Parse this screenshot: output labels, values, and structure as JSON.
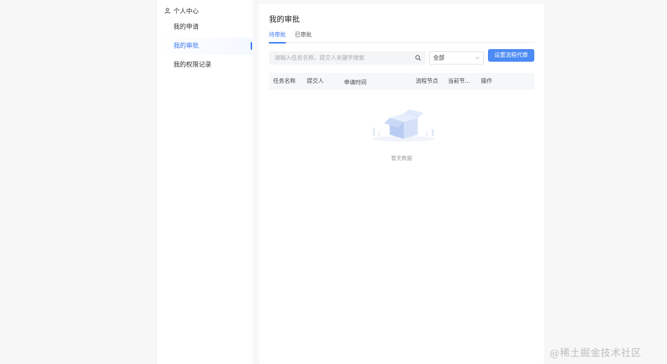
{
  "sidebar": {
    "header": {
      "icon": "person-icon",
      "label": "个人中心"
    },
    "items": [
      {
        "label": "我的申请",
        "active": false
      },
      {
        "label": "我的审批",
        "active": true
      },
      {
        "label": "我的权限记录",
        "active": false
      }
    ]
  },
  "main": {
    "title": "我的审批",
    "tabs": [
      {
        "label": "待审批",
        "active": true
      },
      {
        "label": "已审批",
        "active": false
      }
    ],
    "search": {
      "placeholder": "请输入任务名称、提交人关键字搜索",
      "value": "",
      "icon": "search-icon"
    },
    "filter": {
      "selected": "全部",
      "icon": "chevron-down-icon"
    },
    "action_button": {
      "label": "设置流程代审"
    },
    "table": {
      "columns": [
        "任务名称",
        "提交人",
        "申请时间",
        "流程节点",
        "当前节...",
        "操作"
      ],
      "rows": []
    },
    "empty": {
      "text": "暂无数据",
      "icon": "empty-box-icon"
    }
  },
  "watermark": "@稀土掘金技术社区",
  "colors": {
    "accent": "#3a7af2",
    "button": "#4c8bf5",
    "background": "#f7f7f8"
  }
}
